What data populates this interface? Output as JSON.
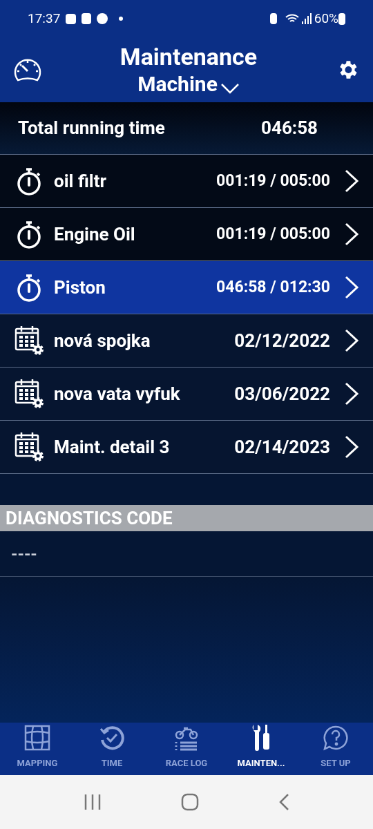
{
  "status_bar": {
    "time": "17:37",
    "battery": "60%"
  },
  "header": {
    "title": "Maintenance",
    "subtitle": "Machine"
  },
  "total": {
    "label": "Total running time",
    "value": "046:58"
  },
  "items": [
    {
      "kind": "timer",
      "name": "oil filtr",
      "value": "001:19 / 005:00",
      "selected": false
    },
    {
      "kind": "timer",
      "name": "Engine Oil",
      "value": "001:19 / 005:00",
      "selected": false
    },
    {
      "kind": "timer",
      "name": "Piston",
      "value": "046:58 / 012:30",
      "selected": true
    },
    {
      "kind": "calendar",
      "name": "nová spojka",
      "value": "02/12/2022",
      "selected": false
    },
    {
      "kind": "calendar",
      "name": "nova vata vyfuk",
      "value": "03/06/2022",
      "selected": false
    },
    {
      "kind": "calendar",
      "name": "Maint. detail 3",
      "value": "02/14/2023",
      "selected": false
    }
  ],
  "diagnostics": {
    "title": "DIAGNOSTICS CODE",
    "value": "----"
  },
  "tabs": [
    {
      "kind": "map",
      "label": "MAPPING",
      "selected": false
    },
    {
      "kind": "time",
      "label": "TIME",
      "selected": false
    },
    {
      "kind": "racelog",
      "label": "RACE LOG",
      "selected": false
    },
    {
      "kind": "tools",
      "label": "MAINTEN...",
      "selected": true
    },
    {
      "kind": "help",
      "label": "SET UP",
      "selected": false
    }
  ]
}
